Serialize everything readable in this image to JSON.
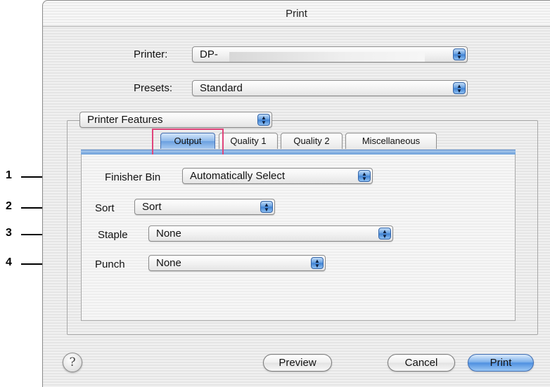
{
  "window": {
    "title": "Print"
  },
  "printer": {
    "label": "Printer:",
    "value": "DP-"
  },
  "presets": {
    "label": "Presets:",
    "value": "Standard"
  },
  "panel_menu": {
    "value": "Printer Features"
  },
  "tabs": [
    {
      "label": "Output",
      "active": true
    },
    {
      "label": "Quality 1",
      "active": false
    },
    {
      "label": "Quality 2",
      "active": false
    },
    {
      "label": "Miscellaneous",
      "active": false
    }
  ],
  "options": {
    "finisher_bin": {
      "label": "Finisher Bin",
      "value": "Automatically Select"
    },
    "sort": {
      "label": "Sort",
      "value": "Sort"
    },
    "staple": {
      "label": "Staple",
      "value": "None"
    },
    "punch": {
      "label": "Punch",
      "value": "None"
    }
  },
  "callouts": [
    "1",
    "2",
    "3",
    "4"
  ],
  "buttons": {
    "help": "?",
    "preview": "Preview",
    "cancel": "Cancel",
    "print": "Print"
  },
  "colors": {
    "highlight": "#e0457b",
    "accent": "#4f90e0"
  }
}
